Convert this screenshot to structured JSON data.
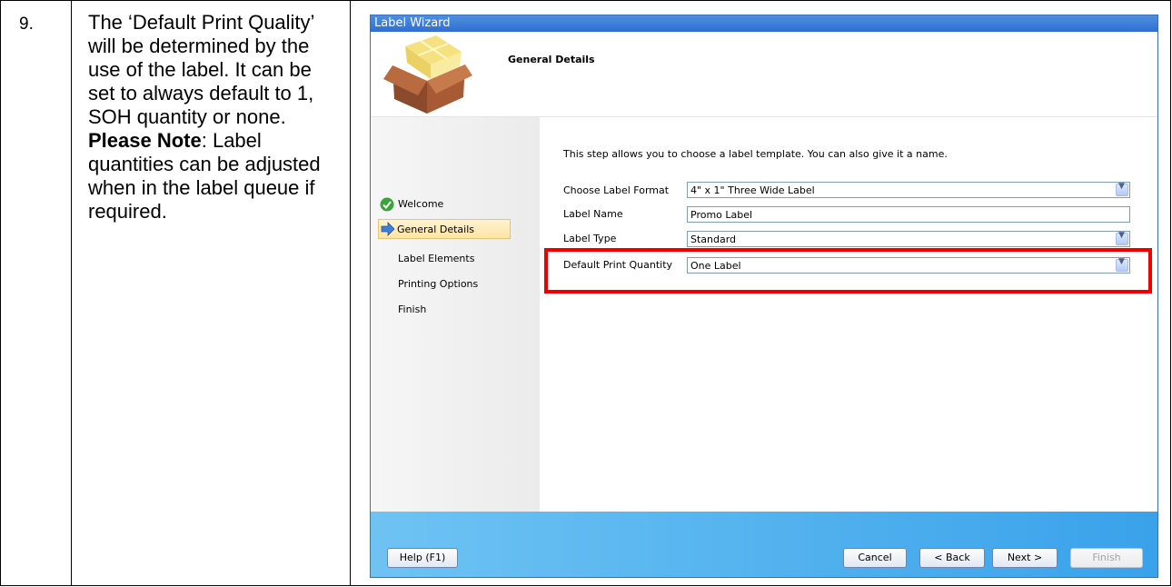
{
  "document": {
    "step_number": "9.",
    "instruction_part1": "The ‘Default Print Quality’ will be determined by the use of the label. It can be set to always default to 1, SOH quantity or none. ",
    "instruction_bold": "Please Note",
    "instruction_part2": ": Label quantities can be adjusted when in the label queue if required."
  },
  "wizard": {
    "title": "Label Wizard",
    "header_title": "General Details",
    "icon": "package-box-icon",
    "description": "This step allows you to choose a label template. You can also give it a name.",
    "nav": [
      {
        "label": "Welcome",
        "icon": "check-circle-icon",
        "status": "done"
      },
      {
        "label": "General Details",
        "icon": "arrow-right-icon",
        "status": "active"
      },
      {
        "label": "Label Elements",
        "icon": "",
        "status": "pending"
      },
      {
        "label": "Printing Options",
        "icon": "",
        "status": "pending"
      },
      {
        "label": "Finish",
        "icon": "",
        "status": "pending"
      }
    ],
    "fields": {
      "label_format": {
        "label": "Choose Label Format",
        "value": "4\" x 1\" Three Wide Label"
      },
      "label_name": {
        "label": "Label Name",
        "value": "Promo Label"
      },
      "label_type": {
        "label": "Label Type",
        "value": "Standard"
      },
      "print_quantity": {
        "label": "Default Print Quantity",
        "value": "One Label"
      }
    },
    "buttons": {
      "help": "Help (F1)",
      "cancel": "Cancel",
      "back": "< Back",
      "next": "Next >",
      "finish": "Finish"
    },
    "highlight_color": "#ee0000"
  }
}
